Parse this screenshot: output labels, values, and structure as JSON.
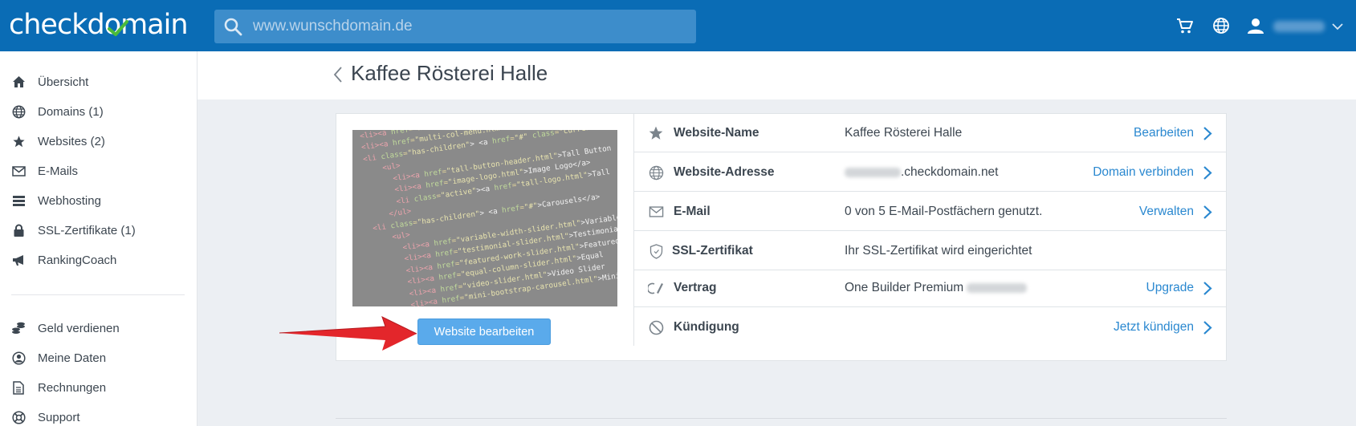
{
  "header": {
    "logo_text": "checkdomain",
    "search_placeholder": "www.wunschdomain.de"
  },
  "sidebar": {
    "primary": [
      {
        "label": "Übersicht",
        "icon": "home-icon"
      },
      {
        "label": "Domains (1)",
        "icon": "globe-icon"
      },
      {
        "label": "Websites (2)",
        "icon": "star-icon"
      },
      {
        "label": "E-Mails",
        "icon": "mail-icon"
      },
      {
        "label": "Webhosting",
        "icon": "server-icon"
      },
      {
        "label": "SSL-Zertifikate (1)",
        "icon": "lock-icon"
      },
      {
        "label": "RankingCoach",
        "icon": "megaphone-icon"
      }
    ],
    "secondary": [
      {
        "label": "Geld verdienen",
        "icon": "coins-icon"
      },
      {
        "label": "Meine Daten",
        "icon": "user-circle-icon"
      },
      {
        "label": "Rechnungen",
        "icon": "document-icon"
      },
      {
        "label": "Support",
        "icon": "lifebuoy-icon"
      }
    ]
  },
  "page": {
    "title": "Kaffee Rösterei Halle",
    "edit_button": "Website bearbeiten"
  },
  "details": [
    {
      "label": "Website-Name",
      "value": "Kaffee Rösterei Halle",
      "action": "Bearbeiten",
      "icon": "star-icon"
    },
    {
      "label": "Website-Adresse",
      "value": ".checkdomain.net",
      "action": "Domain verbinden",
      "icon": "globe-icon"
    },
    {
      "label": "E-Mail",
      "value": "0 von 5 E-Mail-Postfächern genutzt.",
      "action": "Verwalten",
      "icon": "mail-icon"
    },
    {
      "label": "SSL-Zertifikat",
      "value": "Ihr SSL-Zertifikat wird eingerichtet",
      "action": "",
      "icon": "shield-icon"
    },
    {
      "label": "Vertrag",
      "value": "One Builder Premium",
      "action": "Upgrade",
      "icon": "contract-icon"
    },
    {
      "label": "Kündigung",
      "value": "",
      "action": "Jetzt kündigen",
      "icon": "cancel-icon"
    }
  ],
  "colors": {
    "brand": "#0a6cb5",
    "link": "#2a88d0",
    "button": "#5aaaeb",
    "annotation_arrow": "#e3262b"
  }
}
